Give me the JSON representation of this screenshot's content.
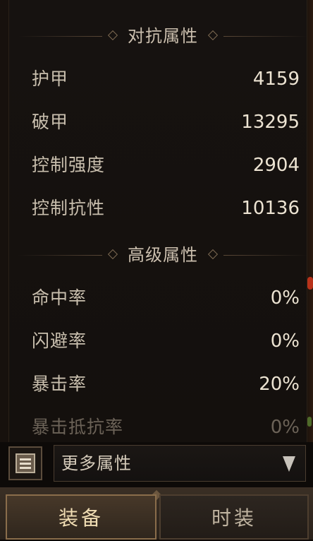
{
  "sections": {
    "resistance": {
      "title": "对抗属性",
      "rows": [
        {
          "label": "护甲",
          "value": "4159"
        },
        {
          "label": "破甲",
          "value": "13295"
        },
        {
          "label": "控制强度",
          "value": "2904"
        },
        {
          "label": "控制抗性",
          "value": "10136"
        }
      ]
    },
    "advanced": {
      "title": "高级属性",
      "rows": [
        {
          "label": "命中率",
          "value": "0%"
        },
        {
          "label": "闪避率",
          "value": "0%"
        },
        {
          "label": "暴击率",
          "value": "20%"
        },
        {
          "label": "暴击抵抗率",
          "value": "0%"
        }
      ]
    }
  },
  "bottom": {
    "more_label": "更多属性",
    "bag_icon": "inventory-scroll-icon",
    "dropdown_icon": "chevron-down-icon"
  },
  "tabs": [
    {
      "label": "装备",
      "active": true
    },
    {
      "label": "时装",
      "active": false
    }
  ],
  "colors": {
    "label": "#c9bfae",
    "value": "#ece3d2",
    "accent": "#8a6d4b"
  }
}
